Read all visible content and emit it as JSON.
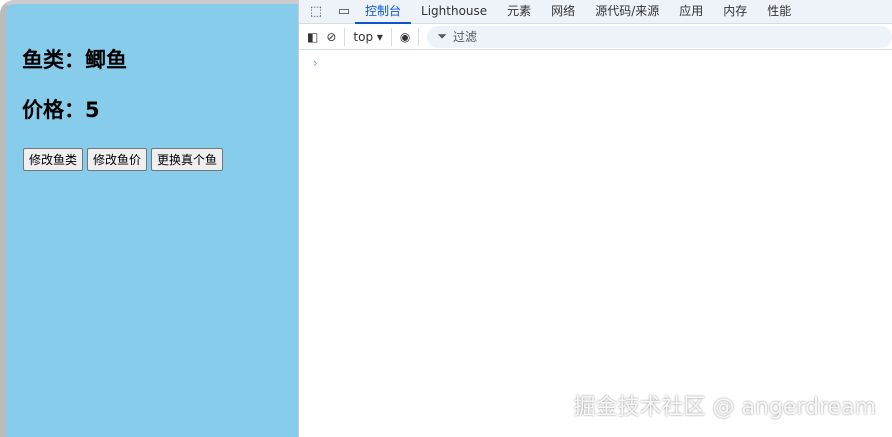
{
  "page": {
    "fish_label": "鱼类：鲫鱼",
    "price_label": "价格：5",
    "buttons": [
      "修改鱼类",
      "修改鱼价",
      "更换真个鱼"
    ]
  },
  "devtools": {
    "tabs": [
      "控制台",
      "Lighthouse",
      "元素",
      "网络",
      "源代码/来源",
      "应用",
      "内存",
      "性能"
    ],
    "context": "top ▾",
    "filter_placeholder": "过滤",
    "prompt": "›"
  },
  "watermark": "掘金技术社区 @ angerdream"
}
